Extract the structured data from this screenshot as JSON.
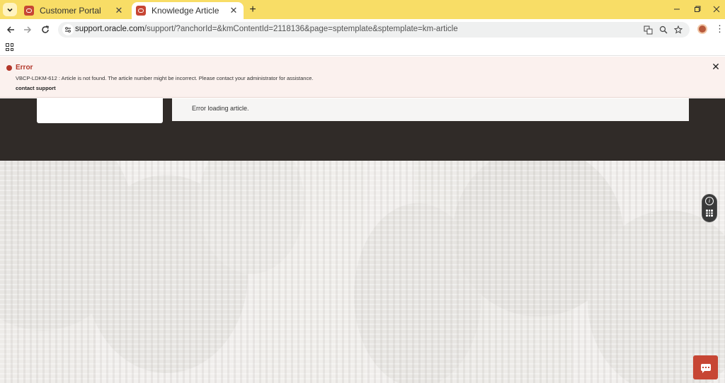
{
  "browser": {
    "tabs": [
      {
        "title": "Customer Portal",
        "active": false
      },
      {
        "title": "Knowledge Article",
        "active": true
      }
    ],
    "new_tab_label": "+",
    "url_host": "support.oracle.com",
    "url_path": "/support/?anchorId=&kmContentId=2118136&page=sptemplate&sptemplate=km-article",
    "icons": {
      "back": "arrow-back-icon",
      "forward": "arrow-forward-icon",
      "reload": "reload-icon",
      "translate": "translate-icon",
      "zoom": "zoom-icon",
      "bookmark": "star-icon",
      "menu": "more-vert-icon"
    }
  },
  "error_banner": {
    "title": "Error",
    "message": "VBCP-LDKM-612 : Article is not found. The article number might be incorrect. Please contact your administrator for assistance.",
    "link": "contact support",
    "color": "#b3372a"
  },
  "article": {
    "status_message": "Error loading article."
  },
  "widgets": {
    "info_glyph": "i"
  },
  "colors": {
    "tabstrip": "#f8dd66",
    "dark_band": "#302b28",
    "brand_red": "#c74634"
  }
}
